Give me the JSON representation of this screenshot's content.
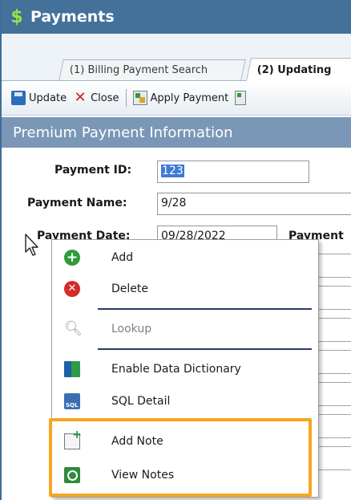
{
  "window": {
    "title": "Payments",
    "icon": "dollar-icon",
    "accent": "#43719a"
  },
  "tabs": [
    {
      "label": "(1) Billing Payment Search",
      "active": false
    },
    {
      "label": "(2) Updating",
      "active": true
    }
  ],
  "toolbar": {
    "update_label": "Update",
    "close_label": "Close",
    "apply_label": "Apply Payment"
  },
  "section": {
    "title": "Premium Payment Information"
  },
  "form": {
    "payment_id_label": "Payment ID:",
    "payment_id_value": "123",
    "payment_name_label": "Payment Name:",
    "payment_name_value": "9/28",
    "payment_date_label": "Payment Date:",
    "payment_date_value": "09/28/2022",
    "payment_right_label": "Payment"
  },
  "context_menu": {
    "items": [
      {
        "label": "Add",
        "icon": "add-icon",
        "enabled": true
      },
      {
        "label": "Delete",
        "icon": "delete-icon",
        "enabled": true
      },
      {
        "label": "Lookup",
        "icon": "lookup-icon",
        "enabled": false
      },
      {
        "label": "Enable Data Dictionary",
        "icon": "data-dictionary-icon",
        "enabled": true
      },
      {
        "label": "SQL Detail",
        "icon": "sql-detail-icon",
        "enabled": true
      },
      {
        "label": "Add Note",
        "icon": "add-note-icon",
        "enabled": true
      },
      {
        "label": "View Notes",
        "icon": "view-notes-icon",
        "enabled": true
      }
    ],
    "highlight_color": "#f5a623"
  }
}
